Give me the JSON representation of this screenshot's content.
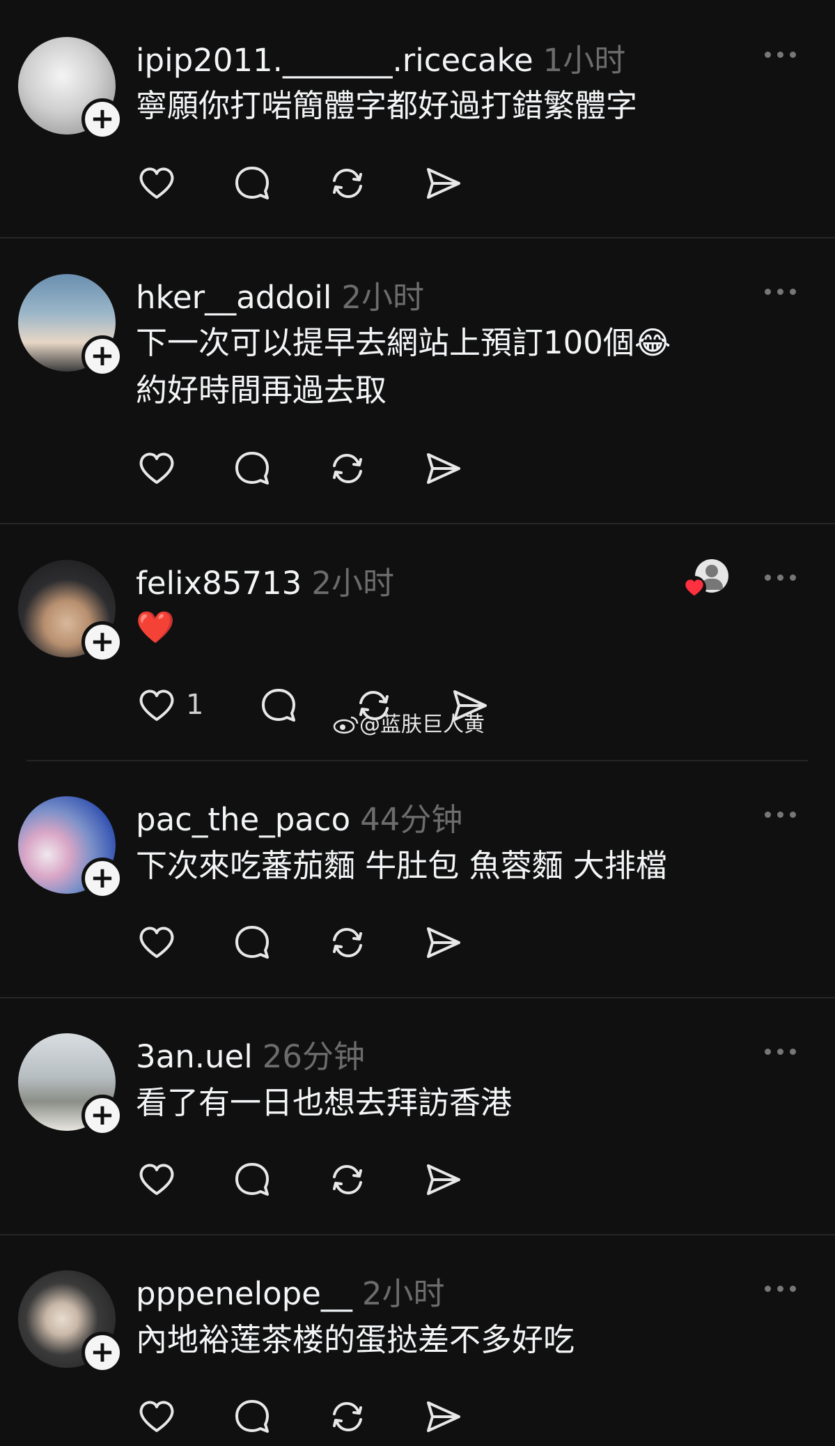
{
  "posts": [
    {
      "username": "ipip2011._______.ricecake",
      "time": "1小时",
      "content": "寧願你打啱簡體字都好過打錯繁體字",
      "like_count": ""
    },
    {
      "username": "hker__addoil",
      "time": "2小时",
      "content": "下一次可以提早去網站上預訂100個😂\n約好時間再過去取",
      "like_count": ""
    },
    {
      "username": "felix85713",
      "time": "2小时",
      "content": "❤️",
      "like_count": "1"
    },
    {
      "username": "pac_the_paco",
      "time": "44分钟",
      "content": "下次來吃蕃茄麵 牛肚包 魚蓉麵 大排檔",
      "like_count": ""
    },
    {
      "username": "3an.uel",
      "time": "26分钟",
      "content": "看了有一日也想去拜訪香港",
      "like_count": ""
    },
    {
      "username": "pppenelope__",
      "time": "2小时",
      "content": "內地裕莲茶楼的蛋挞差不多好吃",
      "like_count": ""
    }
  ],
  "watermark": "@蓝肤巨人黄",
  "icons": [
    "heart-icon",
    "comment-icon",
    "repost-icon",
    "share-icon",
    "more-icon",
    "plus-icon"
  ]
}
